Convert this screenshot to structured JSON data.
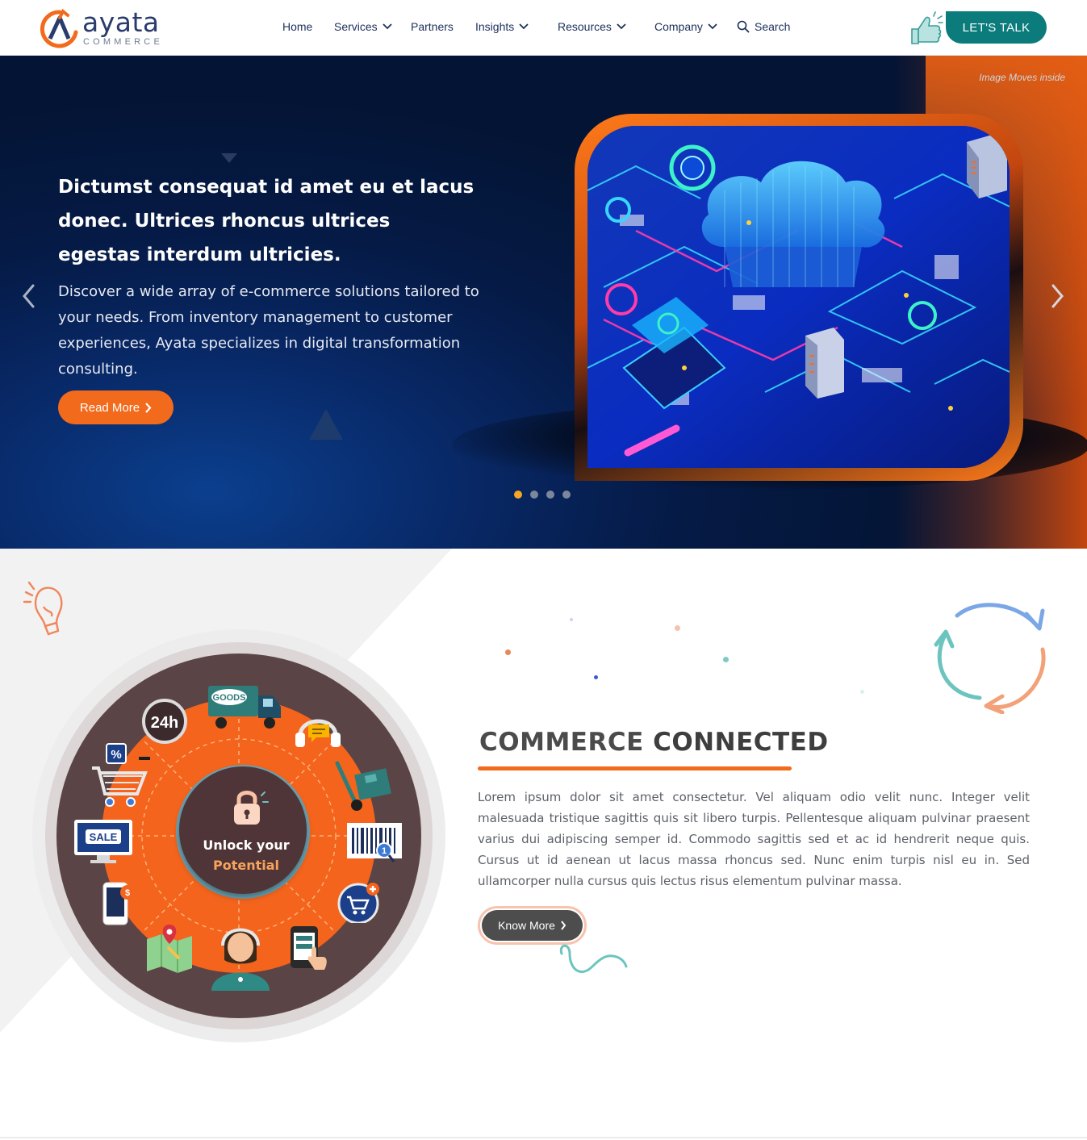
{
  "brand": {
    "name": "ayata",
    "tagline": "COMMERCE",
    "accent": "#f26a1b",
    "teal": "#0b7b7b",
    "navy": "#1c2f5a"
  },
  "nav": {
    "items": [
      {
        "label": "Home",
        "has_dropdown": false
      },
      {
        "label": "Services",
        "has_dropdown": true
      },
      {
        "label": "Partners",
        "has_dropdown": false
      },
      {
        "label": "Insights",
        "has_dropdown": true
      },
      {
        "label": "Resources",
        "has_dropdown": true
      },
      {
        "label": "Company",
        "has_dropdown": true
      }
    ],
    "search_label": "Search",
    "cta_label": "LET'S TALK"
  },
  "hero": {
    "note": "Image Moves inside",
    "title": "Dictumst consequat id amet eu et lacus donec. Ultrices rhoncus ultrices egestas interdum ultricies.",
    "description": "Discover a wide array of e-commerce solutions tailored to your needs. From inventory management to customer experiences, Ayata specializes in digital transformation consulting.",
    "button_label": "Read More",
    "slides_total": 4,
    "active_slide": 1
  },
  "section": {
    "title_light": "COMMERCE",
    "title_bold": "CONNECTED",
    "body": "Lorem ipsum dolor sit amet consectetur. Vel aliquam odio velit nunc. Integer velit malesuada tristique sagittis quis sit libero turpis. Pellentesque aliquam pulvinar praesent varius dui adipiscing semper id. Commodo sagittis sed et ac id hendrerit neque quis. Cursus ut id aenean ut lacus massa rhoncus sed. Nunc enim turpis nisl eu in. Sed ullamcorper nulla cursus quis lectus risus elementum pulvinar massa.",
    "button_label": "Know More"
  },
  "wheel": {
    "center_line1": "Unlock your",
    "center_line2": "Potential",
    "label_24h": "24h",
    "label_goods": "GOODS",
    "label_sale": "SALE",
    "label_percent": "%",
    "label_dollar": "$",
    "label_barcode_badge": "1",
    "icons": [
      "24h-clock-icon",
      "delivery-truck-icon",
      "headset-chat-icon",
      "hand-truck-icon",
      "barcode-scan-icon",
      "cart-plus-icon",
      "mobile-tap-icon",
      "support-agent-icon",
      "map-pin-icon",
      "mobile-payment-icon",
      "sale-monitor-icon",
      "shopping-cart-discount-icon",
      "lock-icon"
    ]
  }
}
